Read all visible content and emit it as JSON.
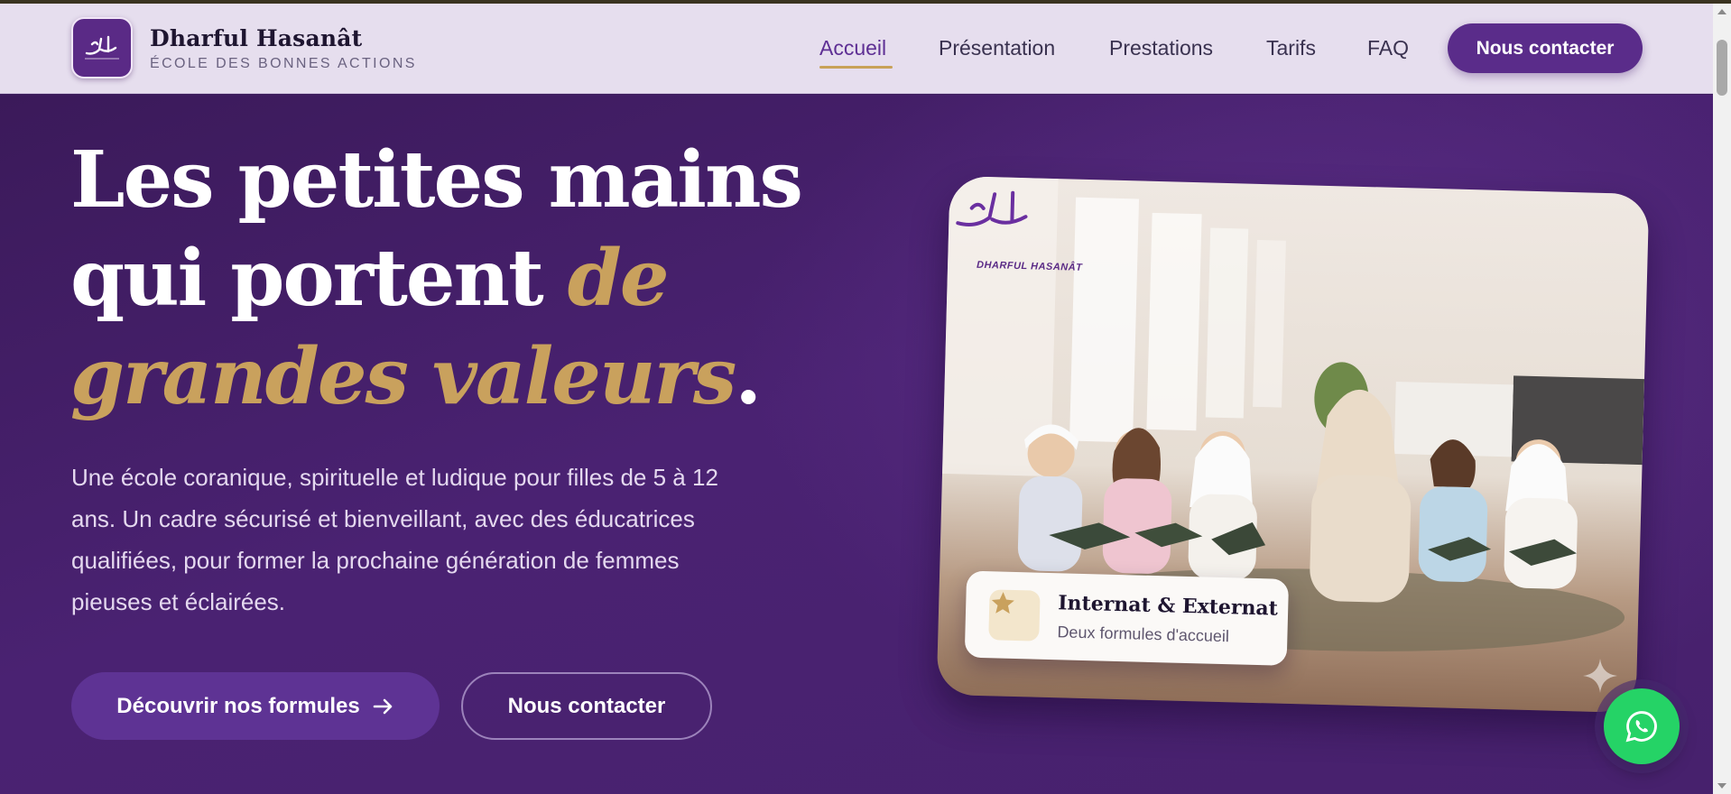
{
  "brand": {
    "name": "Dharful Hasanât",
    "tagline": "ÉCOLE DES BONNES ACTIONS"
  },
  "nav": {
    "items": [
      {
        "label": "Accueil",
        "active": true
      },
      {
        "label": "Présentation",
        "active": false
      },
      {
        "label": "Prestations",
        "active": false
      },
      {
        "label": "Tarifs",
        "active": false
      },
      {
        "label": "FAQ",
        "active": false
      }
    ],
    "cta": "Nous contacter"
  },
  "hero": {
    "headline_line1": "Les petites mains",
    "headline_line2_white": "qui portent ",
    "headline_line2_gold": "de",
    "headline_line3_gold": "grandes valeurs",
    "headline_period": ".",
    "description": "Une école coranique, spirituelle et ludique pour filles de 5 à 12 ans. Un cadre sécurisé et bienveillant, avec des éducatrices qualifiées, pour former la prochaine génération de femmes pieuses et éclairées.",
    "primary_button": "Découvrir nos formules",
    "secondary_button": "Nous contacter"
  },
  "image_card": {
    "logo_caption": "DHARFUL HASANÂT",
    "badge_title": "Internat & Externat",
    "badge_subtitle": "Deux formules d'accueil",
    "badge_icon": "star-icon"
  },
  "colors": {
    "purple": "#5a2c8a",
    "gold": "#c9a15d",
    "whatsapp": "#25d366"
  }
}
